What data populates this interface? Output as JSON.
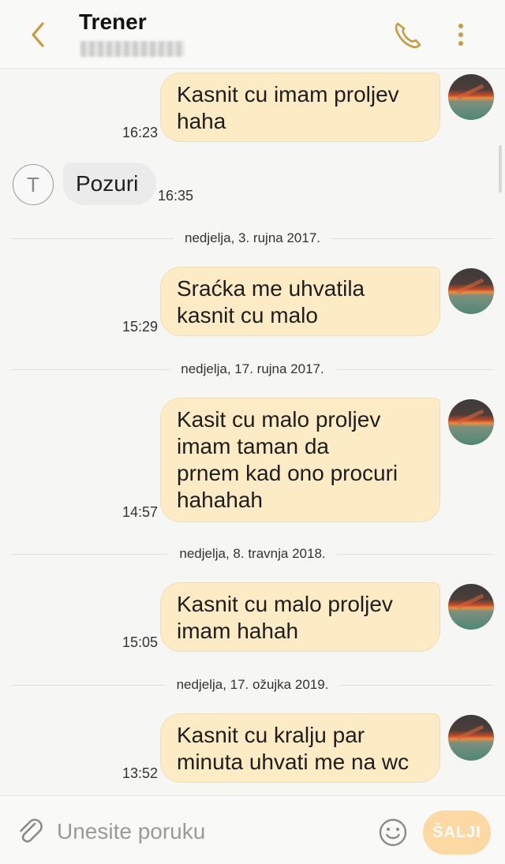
{
  "header": {
    "title": "Trener",
    "subtitle": "·········",
    "back_icon": "chevron-left-icon",
    "call_icon": "phone-icon",
    "menu_icon": "more-vertical-icon",
    "accent_color": "#c99a3f"
  },
  "messages": [
    {
      "id": "m1",
      "direction": "outgoing",
      "text_lines": [
        "Kasnit cu imam proljev",
        "haha"
      ],
      "time": "16:23"
    },
    {
      "id": "m2",
      "direction": "incoming",
      "avatar_letter": "T",
      "text_lines": [
        "Pozuri"
      ],
      "time": "16:35"
    },
    {
      "id": "d1",
      "type": "date",
      "label": "nedjelja, 3. rujna 2017."
    },
    {
      "id": "m3",
      "direction": "outgoing",
      "text_lines": [
        "Sraćka me uhvatila",
        "kasnit cu malo"
      ],
      "time": "15:29"
    },
    {
      "id": "d2",
      "type": "date",
      "label": "nedjelja, 17. rujna 2017."
    },
    {
      "id": "m4",
      "direction": "outgoing",
      "text_lines": [
        "Kasit cu malo proljev",
        "imam taman da",
        "prnem kad ono procuri",
        "hahahah"
      ],
      "time": "14:57"
    },
    {
      "id": "d3",
      "type": "date",
      "label": "nedjelja, 8. travnja 2018."
    },
    {
      "id": "m5",
      "direction": "outgoing",
      "text_lines": [
        "Kasnit cu malo proljev",
        "imam hahah"
      ],
      "time": "15:05"
    },
    {
      "id": "d4",
      "type": "date",
      "label": "nedjelja, 17. ožujka 2019."
    },
    {
      "id": "m6",
      "direction": "outgoing",
      "text_lines": [
        "Kasnit cu kralju par",
        "minuta uhvati me na wc"
      ],
      "time": "13:52"
    }
  ],
  "compose": {
    "placeholder": "Unesite poruku",
    "value": "",
    "send_label": "ŠALJI",
    "attach_icon": "paperclip-icon",
    "emoji_icon": "smiley-icon"
  },
  "colors": {
    "outgoing_bubble": "#fcebc5",
    "incoming_bubble": "#ebebeb",
    "send_button": "#fcd9a3"
  }
}
